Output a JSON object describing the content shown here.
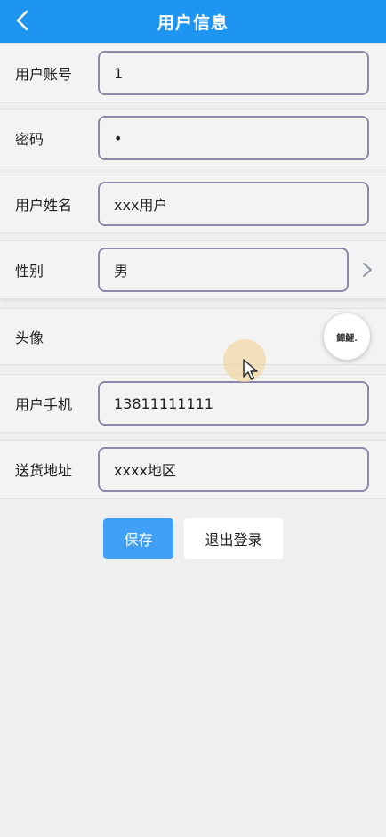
{
  "header": {
    "title": "用户信息",
    "background": "#1e95f0"
  },
  "form": {
    "account": {
      "label": "用户账号",
      "value": "1"
    },
    "password": {
      "label": "密码",
      "value": "•"
    },
    "name": {
      "label": "用户姓名",
      "value": "xxx用户"
    },
    "gender": {
      "label": "性别",
      "value": "男"
    },
    "avatar": {
      "label": "头像",
      "image_text": "錦鯉."
    },
    "phone": {
      "label": "用户手机",
      "value": "13811111111"
    },
    "address": {
      "label": "送货地址",
      "value": "xxxx地区"
    }
  },
  "actions": {
    "save_label": "保存",
    "logout_label": "退出登录",
    "save_color": "#40a0f7"
  },
  "icons": {
    "back": "chevron-left-icon",
    "gender_select": "chevron-right-icon",
    "cursor": "mouse-pointer-icon"
  }
}
